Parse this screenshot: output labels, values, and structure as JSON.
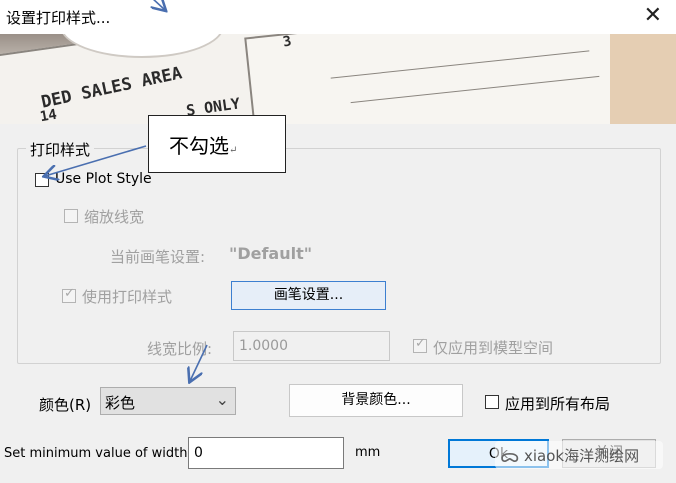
{
  "window": {
    "title": "设置打印样式..."
  },
  "banner": {
    "text_sales": "DED SALES AREA",
    "text_only": "S ONLY",
    "text_num": "14",
    "text_3": "3"
  },
  "plot_style_group": {
    "title": "打印样式",
    "use_plot_style": {
      "label": "Use Plot Style",
      "checked": false
    },
    "scale_lineweights": {
      "label": "缩放线宽",
      "checked": false
    },
    "current_pen_label": "当前画笔设置:",
    "current_pen_value": "\"Default\"",
    "use_plot_styles": {
      "label": "使用打印样式",
      "checked": true
    },
    "pen_settings_button": "画笔设置...",
    "lineweight_scale_label": "线宽比例:",
    "lineweight_scale_value": "1.0000",
    "model_space_only": {
      "label": "仅应用到模型空间",
      "checked": true
    }
  },
  "color": {
    "label": "颜色(R)",
    "selected": "彩色",
    "background_button": "背景颜色...",
    "apply_all_layouts": {
      "label": "应用到所有布局",
      "checked": false
    }
  },
  "min_width": {
    "label": "Set minimum value of width",
    "value": "0",
    "unit": "mm"
  },
  "buttons": {
    "ok": "Ok",
    "cancel": "关闭"
  },
  "annotation": {
    "callout_text": "不勾选",
    "mark": "↵"
  },
  "watermark": "xiaok海洋测绘网",
  "colors": {
    "callout_arrow": "#4a6fb0",
    "annotation_border": "#222222"
  }
}
